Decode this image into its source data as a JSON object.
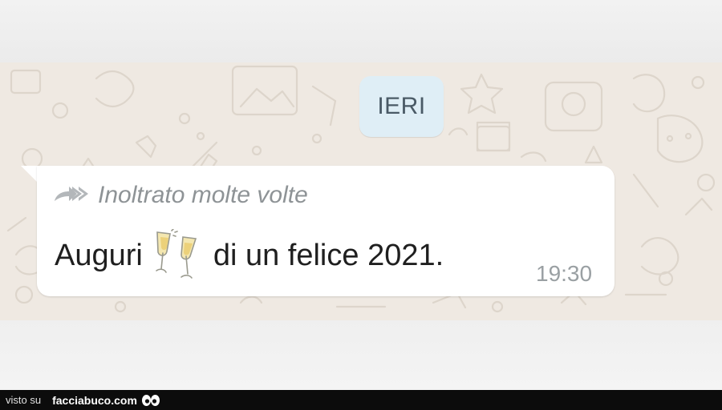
{
  "chat": {
    "date_separator": "IERI",
    "message": {
      "forwarded_label": "Inoltrato molte volte",
      "text_before_emoji": "Auguri",
      "emoji": "clinking-glasses-icon",
      "text_after_emoji": "di un felice 2021.",
      "time": "19:30"
    }
  },
  "watermark": {
    "prefix": "visto su",
    "brand": "facciabuco.com",
    "logo": "eyes-icon"
  },
  "colors": {
    "wallpaper": "#efe9e2",
    "date_chip": "#dfeef6",
    "bubble": "#ffffff",
    "meta_text": "#8e9396",
    "watermark_bar": "#0c0c0c"
  }
}
